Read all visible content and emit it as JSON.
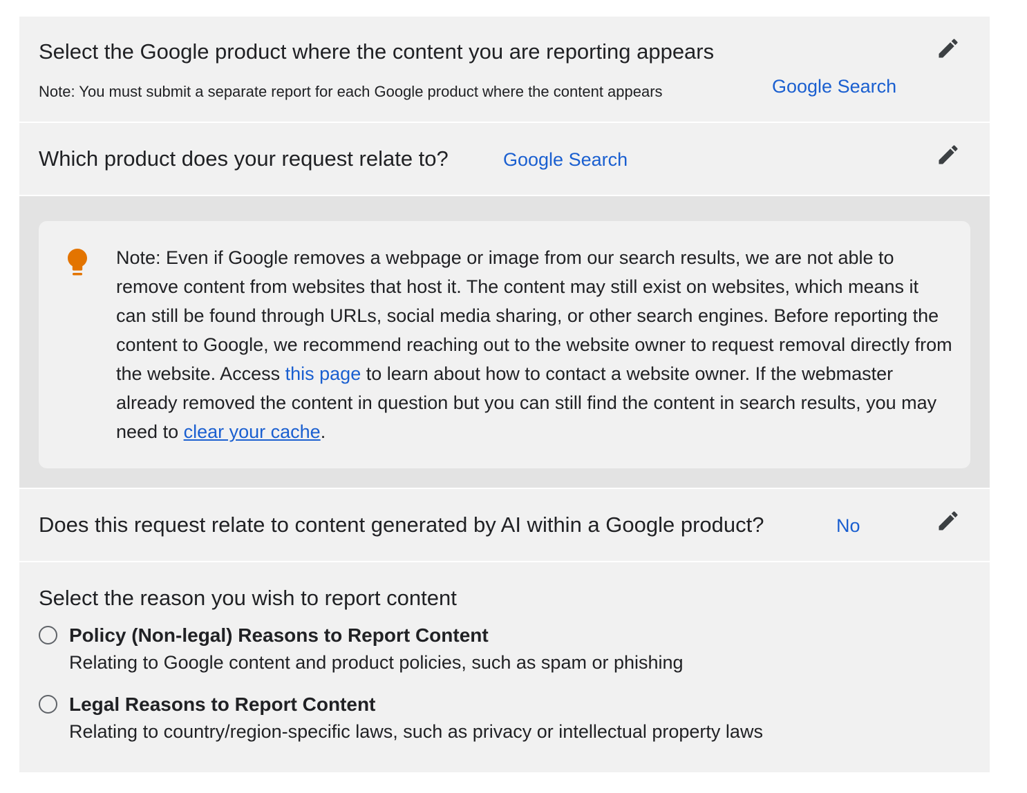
{
  "product_question": {
    "title": "Select the Google product where the content you are reporting appears",
    "note": "Note: You must submit a separate report for each Google product where the content appears",
    "answer": "Google Search",
    "edit_icon": "pencil-icon"
  },
  "relate_question": {
    "title": "Which product does your request relate to?",
    "answer": "Google Search",
    "edit_icon": "pencil-icon"
  },
  "info_note": {
    "icon": "lightbulb-icon",
    "icon_color": "#e37400",
    "text_before_link": "Note: Even if Google removes a webpage or image from our search results, we are not able to remove content from websites that host it. The content may still exist on websites, which means it can still be found through URLs, social media sharing, or other search engines. Before reporting the content to Google, we recommend reaching out to the website owner to request removal directly from the website. Access ",
    "link1": "this page",
    "text_middle": " to learn about how to contact a website owner. If the webmaster already removed the content in question but you can still find the content in search results, you may need to ",
    "link2": "clear your cache",
    "text_end": "."
  },
  "ai_question": {
    "title": "Does this request relate to content generated by AI within a Google product?",
    "answer": "No",
    "edit_icon": "pencil-icon"
  },
  "reason_question": {
    "title": "Select the reason you wish to report content",
    "options": [
      {
        "label": "Policy (Non-legal) Reasons to Report Content",
        "description": "Relating to Google content and product policies, such as spam or phishing"
      },
      {
        "label": "Legal Reasons to Report Content",
        "description": "Relating to country/region-specific laws, such as privacy or intellectual property laws"
      }
    ]
  },
  "colors": {
    "link": "#1a5fd0",
    "panel": "#f1f1f1",
    "note_section": "#e3e3e3",
    "text": "#202124"
  }
}
